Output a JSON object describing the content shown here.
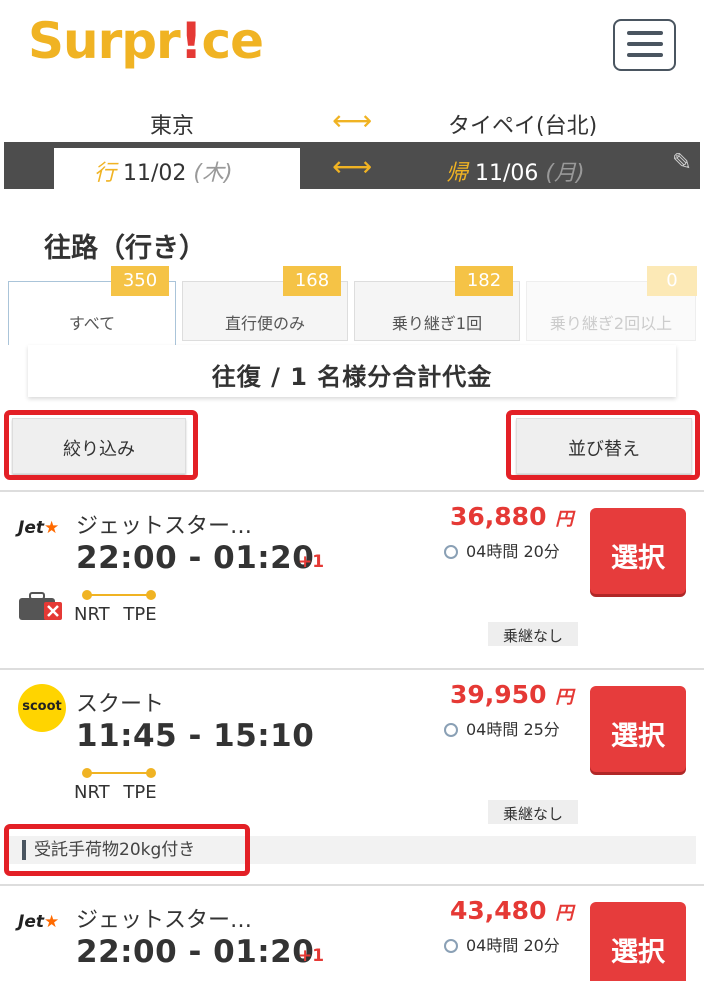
{
  "brand": {
    "logo_pre": "Surpr",
    "logo_bang": "!",
    "logo_post": "ce"
  },
  "route": {
    "from": "東京",
    "to": "タイペイ(台北)",
    "arrow": "⟷"
  },
  "dates": {
    "outbound_kanji": "行",
    "outbound_date": "11/02",
    "outbound_dow": "(木)",
    "return_kanji": "帰",
    "return_date": "11/06",
    "return_dow": "(月)"
  },
  "section_title": "往路（行き）",
  "tabs": [
    {
      "label": "すべて",
      "count": "350"
    },
    {
      "label": "直行便のみ",
      "count": "168"
    },
    {
      "label": "乗り継ぎ1回",
      "count": "182"
    },
    {
      "label": "乗り継ぎ2回以上",
      "count": "0"
    }
  ],
  "summary": "往復 / 1 名様分合計代金",
  "filter_label": "絞り込み",
  "sort_label": "並び替え",
  "yen": "円",
  "select_label": "選択",
  "flights": [
    {
      "airline": "ジェットスター…",
      "logo": "Jet",
      "times": "22:00 - 01:20",
      "plus": "+1",
      "price": "36,880",
      "duration": "04時間 20分",
      "from": "NRT",
      "to": "TPE",
      "stops": "乗継なし"
    },
    {
      "airline": "スクート",
      "logo": "scoot",
      "times": "11:45 - 15:10",
      "plus": "",
      "price": "39,950",
      "duration": "04時間 25分",
      "from": "NRT",
      "to": "TPE",
      "stops": "乗継なし",
      "baggage": "受託手荷物20kg付き"
    },
    {
      "airline": "ジェットスター…",
      "logo": "Jet",
      "times": "22:00 - 01:20",
      "plus": "+1",
      "price": "43,480",
      "duration": "04時間 20分"
    }
  ],
  "colors": {
    "accent": "#f0b323",
    "price": "#e53935",
    "select_button": "#e63c3c",
    "highlight_outline": "#e32026"
  }
}
